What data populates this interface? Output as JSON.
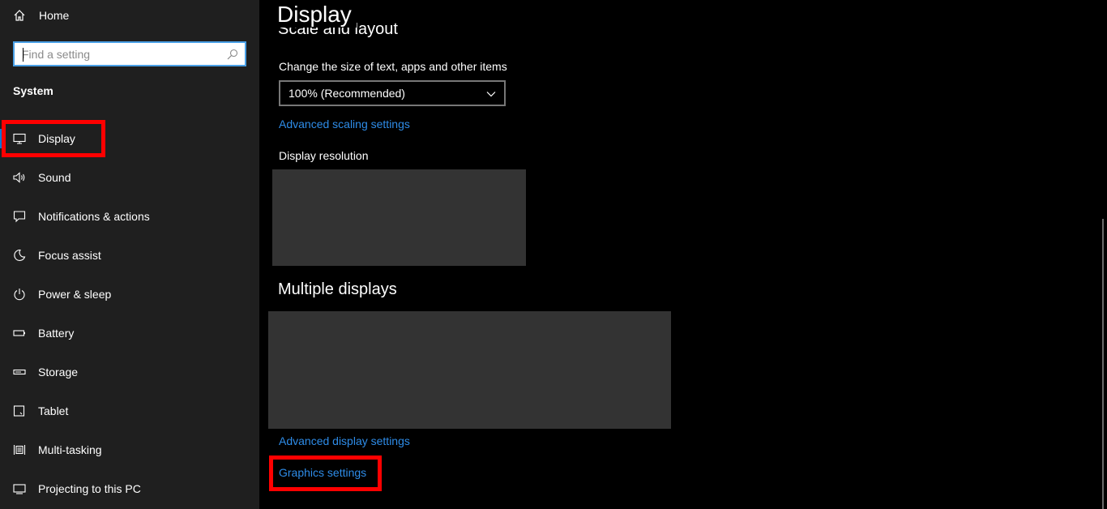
{
  "sidebar": {
    "home_label": "Home",
    "search_placeholder": "Find a setting",
    "section_title": "System",
    "items": [
      {
        "label": "Display",
        "icon": "monitor-icon"
      },
      {
        "label": "Sound",
        "icon": "speaker-icon"
      },
      {
        "label": "Notifications & actions",
        "icon": "notification-icon"
      },
      {
        "label": "Focus assist",
        "icon": "moon-icon"
      },
      {
        "label": "Power & sleep",
        "icon": "power-icon"
      },
      {
        "label": "Battery",
        "icon": "battery-icon"
      },
      {
        "label": "Storage",
        "icon": "storage-icon"
      },
      {
        "label": "Tablet",
        "icon": "tablet-icon"
      },
      {
        "label": "Multi-tasking",
        "icon": "multitasking-icon"
      },
      {
        "label": "Projecting to this PC",
        "icon": "projecting-icon"
      }
    ],
    "active_item": "Display"
  },
  "main": {
    "title": "Display",
    "scale_heading": "Scale and layout",
    "scale_label": "Change the size of text, apps and other items",
    "scale_value": "100% (Recommended)",
    "advanced_scaling_link": "Advanced scaling settings",
    "resolution_label": "Display resolution",
    "multiple_heading": "Multiple displays",
    "advanced_display_link": "Advanced display settings",
    "graphics_link": "Graphics settings"
  },
  "colors": {
    "sidebar_bg": "#1f1f1f",
    "main_bg": "#000000",
    "link": "#2e8ce8",
    "highlight": "#ff0000",
    "accent": "#0078d7"
  }
}
